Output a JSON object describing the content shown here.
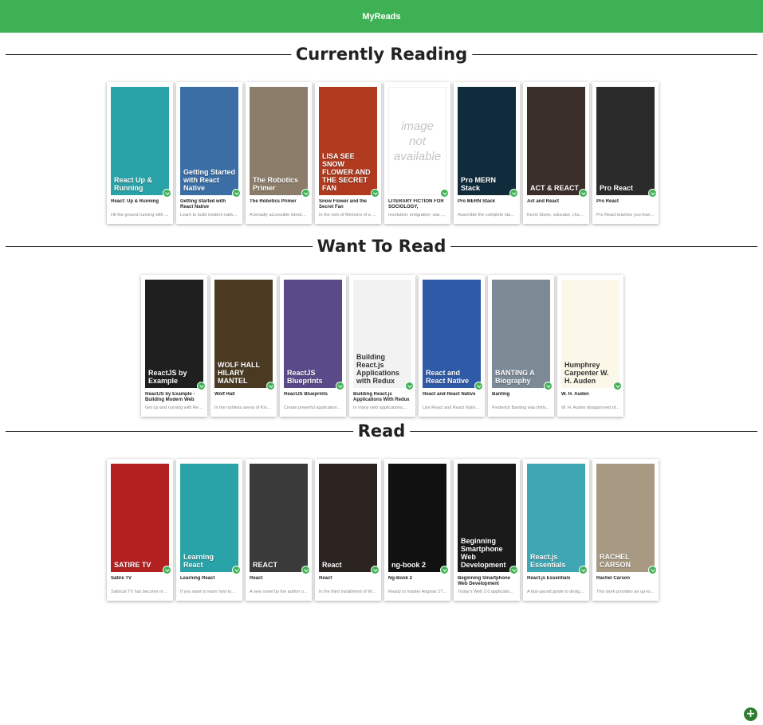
{
  "header": {
    "title": "MyReads"
  },
  "add_button": {
    "label": "+"
  },
  "shelves": [
    {
      "title": "Currently Reading",
      "books": [
        {
          "title": "React: Up & Running",
          "desc": "Hit the ground running with React...",
          "cover_text": "React Up & Running",
          "color": "#2aa3a8"
        },
        {
          "title": "Getting Started with React Native",
          "desc": "Learn to build modern native apps",
          "cover_text": "Getting Started with React Native",
          "color": "#3a6ea5"
        },
        {
          "title": "The Robotics Primer",
          "desc": "A broadly accessible introduction",
          "cover_text": "The Robotics Primer",
          "color": "#8c7d6a"
        },
        {
          "title": "Snow Flower and the Secret Fan",
          "desc": "In the vein of Memoirs of a Geisha",
          "cover_text": "LISA SEE SNOW FLOWER AND THE SECRET FAN",
          "color": "#b03a1e"
        },
        {
          "title": "LITERARY FICTION FOR SOCIOLOGY, PSYCHOLOGY, AND GERONTOLOGY: THE HUMAN PERSPECTIVE REVEALED.",
          "desc": "revolution; emigration; war, ...",
          "cover_text": "image not available",
          "color": "#ffffff",
          "na": true
        },
        {
          "title": "Pro MERN Stack",
          "desc": "Assemble the complete stack...",
          "cover_text": "Pro MERN Stack",
          "color": "#0f2b3c"
        },
        {
          "title": "Act and React",
          "desc": "Kevin Stone, educator, church...",
          "cover_text": "ACT & REACT",
          "color": "#3b2f2a"
        },
        {
          "title": "Pro React",
          "desc": "Pro React teaches you how to...",
          "cover_text": "Pro React",
          "color": "#2b2b2b"
        }
      ]
    },
    {
      "title": "Want To Read",
      "books": [
        {
          "title": "ReactJS by Example - Building Modern Web Applications with React",
          "desc": "Get up and running with React",
          "cover_text": "ReactJS by Example",
          "color": "#1f1f1f"
        },
        {
          "title": "Wolf Hall",
          "desc": "In the ruthless arena of King...",
          "cover_text": "WOLF HALL HILARY MANTEL",
          "color": "#4a3a22"
        },
        {
          "title": "ReactJS Blueprints",
          "desc": "Create powerful applications...",
          "cover_text": "ReactJS Blueprints",
          "color": "#5a4a8a"
        },
        {
          "title": "Building React.js Applications With Redux",
          "desc": "In many web applications,...",
          "cover_text": "Building React.js Applications with Redux",
          "color": "#f2f2f2"
        },
        {
          "title": "React and React Native",
          "desc": "Use React and React Native...",
          "cover_text": "React and React Native",
          "color": "#2f5aa8"
        },
        {
          "title": "Banting",
          "desc": "Frederick Banting was thirty...",
          "cover_text": "BANTING A Biography",
          "color": "#7c8a96"
        },
        {
          "title": "W. H. Auden",
          "desc": "W. H. Auden disapproved of...",
          "cover_text": "Humphrey Carpenter W. H. Auden",
          "color": "#fbf8ea"
        }
      ]
    },
    {
      "title": "Read",
      "books": [
        {
          "title": "Satire TV",
          "desc": "Satirical TV has become ma...",
          "cover_text": "SATIRE TV",
          "color": "#b32020"
        },
        {
          "title": "Learning React",
          "desc": "If you want to learn how to...",
          "cover_text": "Learning React",
          "color": "#2aa3a8"
        },
        {
          "title": "React",
          "desc": "A new novel by the author o...",
          "cover_text": "REACT",
          "color": "#3a3a3a"
        },
        {
          "title": "React",
          "desc": "In the third installment of W...",
          "cover_text": "React",
          "color": "#2c2420"
        },
        {
          "title": "Ng-Book 2",
          "desc": "Ready to master Angular 2?...",
          "cover_text": "ng-book 2",
          "color": "#111111"
        },
        {
          "title": "Beginning Smartphone Web Development",
          "desc": "Today's Web 2.0 applications...",
          "cover_text": "Beginning Smartphone Web Development",
          "color": "#1a1a1a"
        },
        {
          "title": "React.js Essentials",
          "desc": "A fast-paced guide to design...",
          "cover_text": "React.js Essentials",
          "color": "#3fa6b3"
        },
        {
          "title": "Rachel Carson",
          "desc": "This work provides an up-to...",
          "cover_text": "RACHEL CARSON",
          "color": "#a89a82"
        }
      ]
    }
  ]
}
